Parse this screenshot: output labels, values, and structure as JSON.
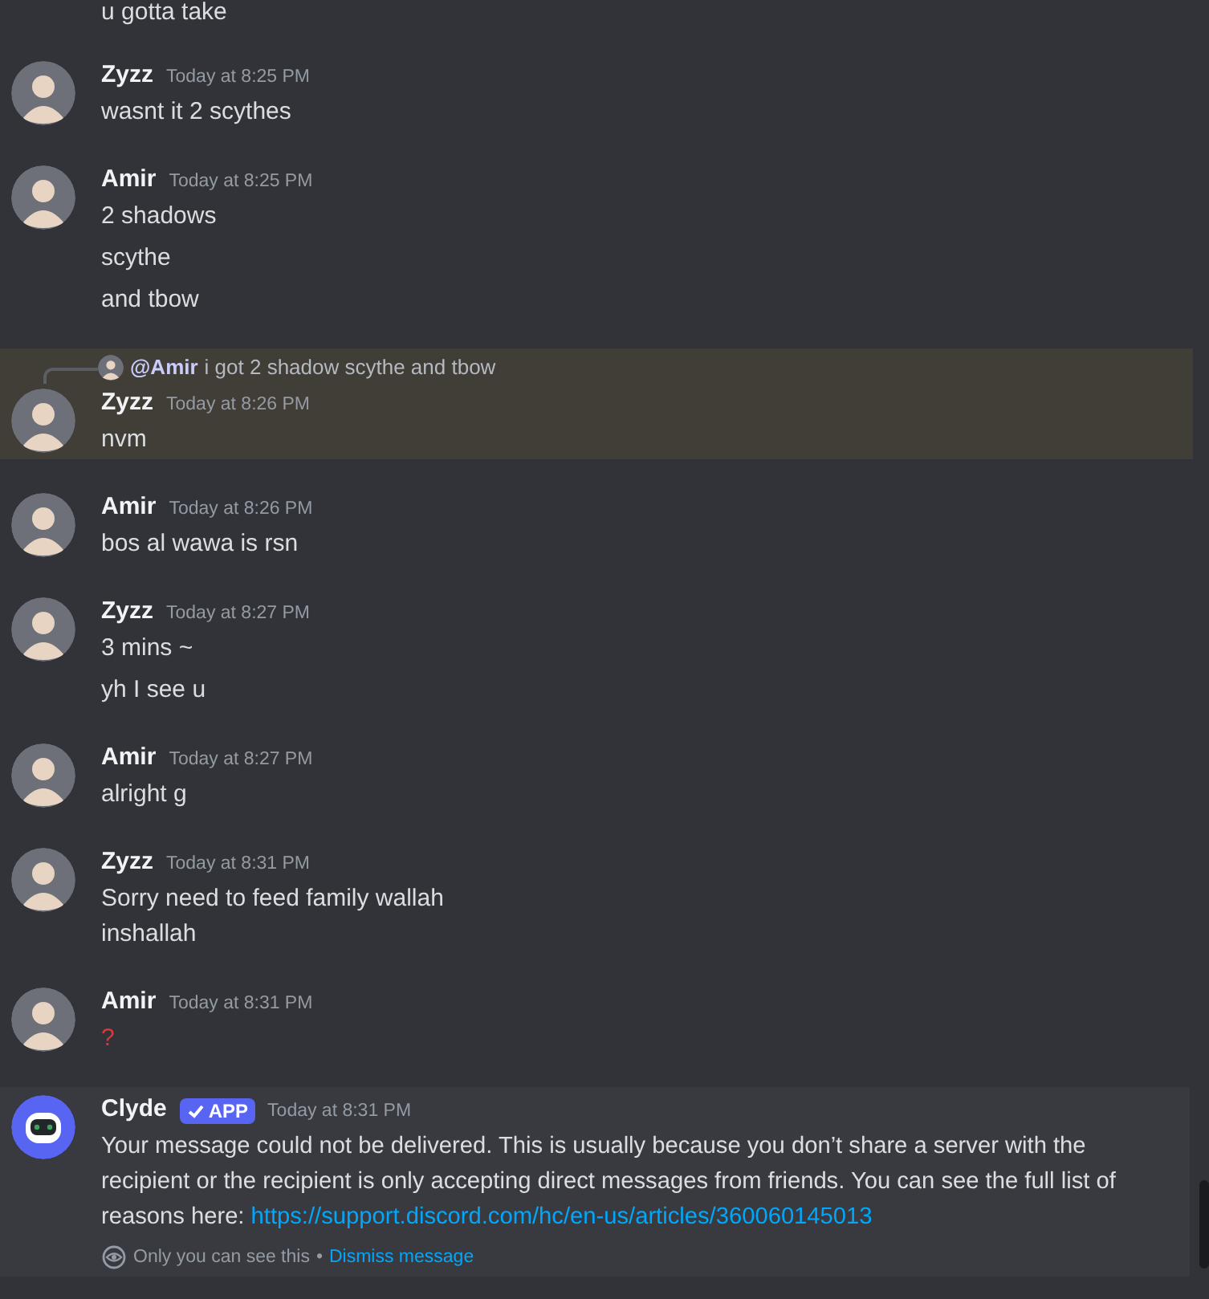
{
  "partial_line": "u gotta take",
  "groups": [
    {
      "author": "Zyzz",
      "time": "Today at 8:25 PM",
      "highlighted": false,
      "messages": [
        {
          "kind": "text",
          "text": "wasnt it 2 scythes"
        }
      ]
    },
    {
      "author": "Amir",
      "time": "Today at 8:25 PM",
      "highlighted": false,
      "messages": [
        {
          "kind": "text",
          "text": "2 shadows"
        },
        {
          "kind": "text",
          "text": "scythe"
        },
        {
          "kind": "text",
          "text": "and tbow"
        }
      ]
    },
    {
      "author": "Zyzz",
      "time": "Today at 8:26 PM",
      "highlighted": true,
      "reply": {
        "mention": "@Amir",
        "text": "i got 2 shadow scythe and tbow"
      },
      "messages": [
        {
          "kind": "text",
          "text": "nvm"
        }
      ]
    },
    {
      "author": "Amir",
      "time": "Today at 8:26 PM",
      "highlighted": false,
      "messages": [
        {
          "kind": "text",
          "text": "bos al wawa is rsn"
        }
      ]
    },
    {
      "author": "Zyzz",
      "time": "Today at 8:27 PM",
      "highlighted": false,
      "messages": [
        {
          "kind": "text",
          "text": "3 mins ~"
        },
        {
          "kind": "text",
          "text": "yh I see u"
        }
      ]
    },
    {
      "author": "Amir",
      "time": "Today at 8:27 PM",
      "highlighted": false,
      "messages": [
        {
          "kind": "text",
          "text": "alright g"
        }
      ]
    },
    {
      "author": "Zyzz",
      "time": "Today at 8:31 PM",
      "highlighted": false,
      "messages": [
        {
          "kind": "text",
          "text": "Sorry need to feed family wallah\ninshallah"
        }
      ]
    },
    {
      "author": "Amir",
      "time": "Today at 8:31 PM",
      "highlighted": false,
      "messages": [
        {
          "kind": "emoji",
          "text": "?"
        }
      ]
    }
  ],
  "system_message": {
    "author": "Clyde",
    "badge": "APP",
    "time": "Today at 8:31 PM",
    "text": "Your message could not be delivered. This is usually because you don’t share a server with the recipient or the recipient is only accepting direct messages from friends. You can see the full list of reasons here:",
    "link": "https://support.discord.com/hc/en-us/articles/360060145013",
    "notice": "Only you can see this",
    "separator": "•",
    "dismiss": "Dismiss message"
  }
}
